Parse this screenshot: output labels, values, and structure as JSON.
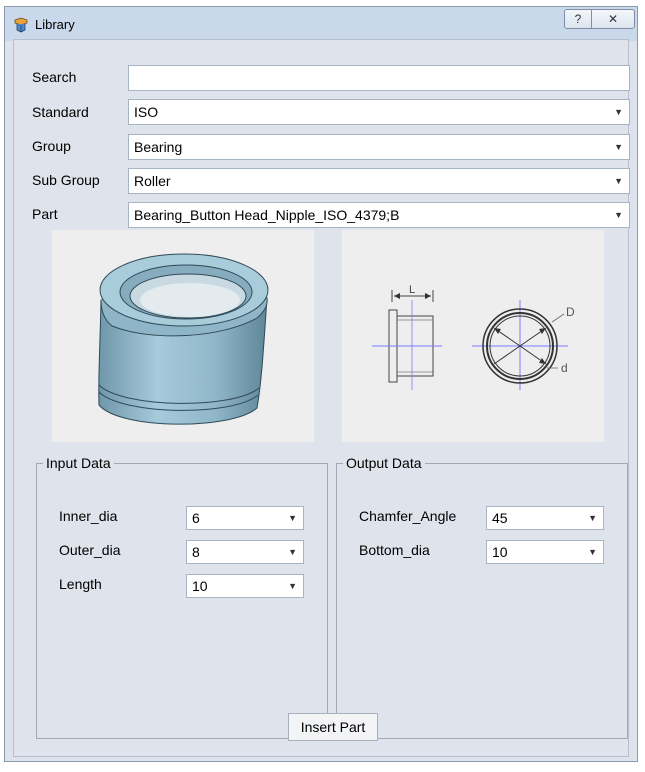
{
  "window": {
    "title": "Library",
    "help_label": "?",
    "close_label": "✕"
  },
  "form": {
    "search": {
      "label": "Search",
      "value": ""
    },
    "standard": {
      "label": "Standard",
      "value": "ISO"
    },
    "group": {
      "label": "Group",
      "value": "Bearing"
    },
    "sub_group": {
      "label": "Sub Group",
      "value": "Roller"
    },
    "part": {
      "label": "Part",
      "value": "Bearing_Button Head_Nipple_ISO_4379;B"
    }
  },
  "drawing": {
    "dim_L": "L",
    "dim_D": "D",
    "dim_d": "d"
  },
  "input_data": {
    "title": "Input Data",
    "fields": [
      {
        "label": "Inner_dia",
        "value": "6"
      },
      {
        "label": "Outer_dia",
        "value": "8"
      },
      {
        "label": "Length",
        "value": "10"
      }
    ]
  },
  "output_data": {
    "title": "Output Data",
    "fields": [
      {
        "label": "Chamfer_Angle",
        "value": "45"
      },
      {
        "label": "Bottom_dia",
        "value": "10"
      }
    ]
  },
  "insert_button": {
    "label": "Insert Part"
  },
  "colors": {
    "part_fill": "#8fb6c8",
    "part_dark": "#5f8799",
    "titlebar": "#c9d8ea",
    "dialog_bg": "#dfe4ec"
  }
}
